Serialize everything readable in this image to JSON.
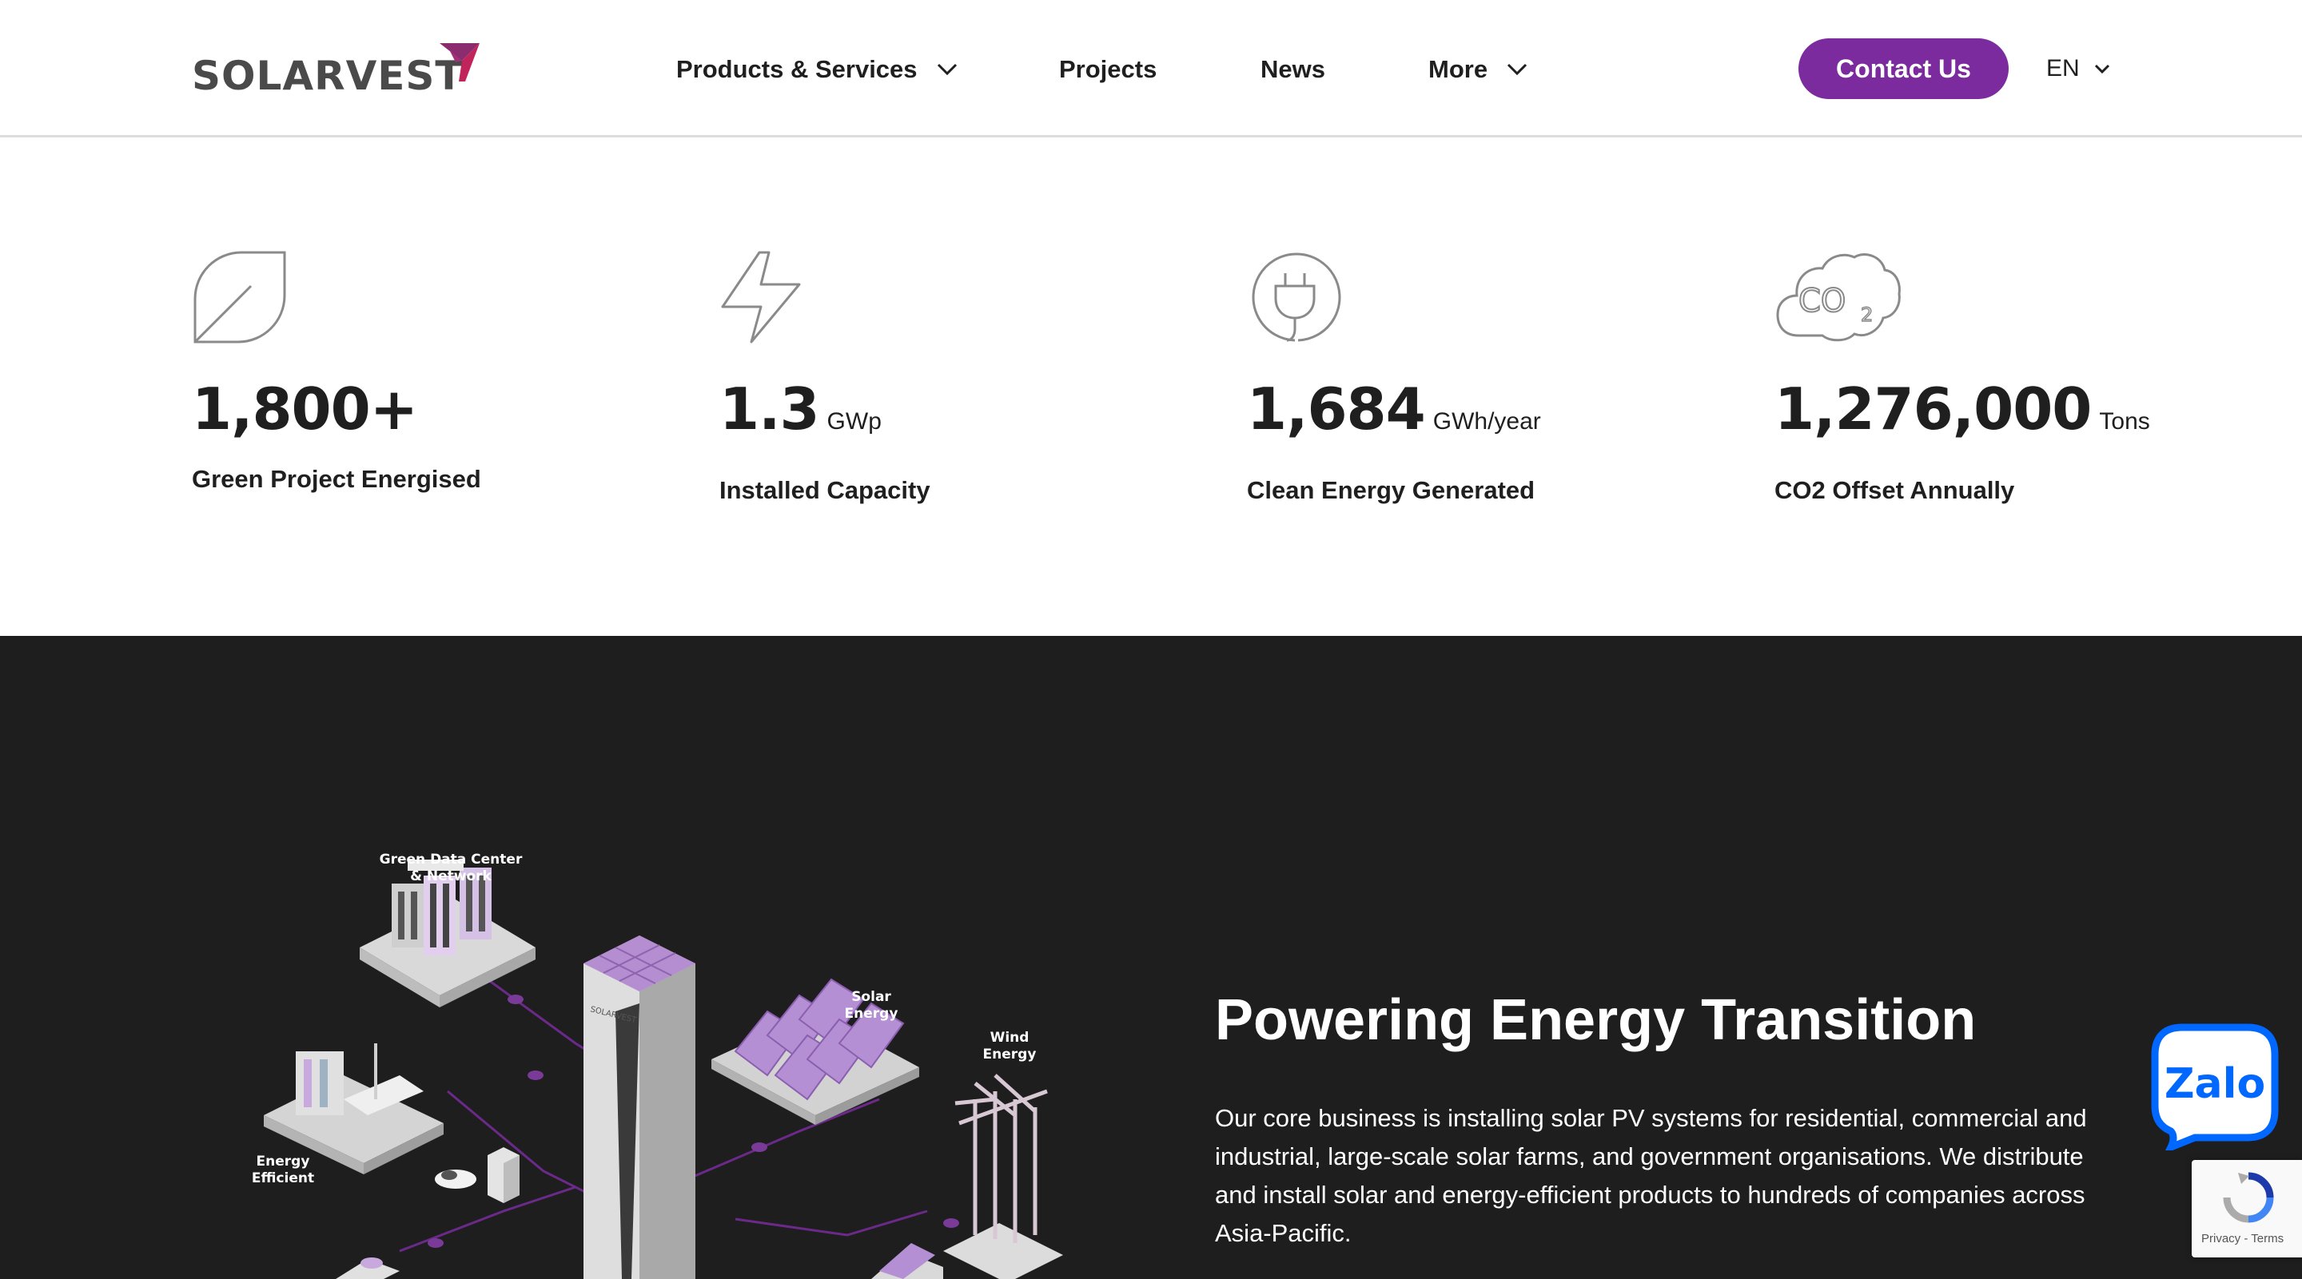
{
  "header": {
    "logo_text": "SOLARVEST",
    "nav": [
      {
        "label": "Products & Services",
        "has_dropdown": true
      },
      {
        "label": "Projects",
        "has_dropdown": false
      },
      {
        "label": "News",
        "has_dropdown": false
      },
      {
        "label": "More",
        "has_dropdown": true
      }
    ],
    "contact_label": "Contact Us",
    "language": "EN"
  },
  "stats": [
    {
      "icon": "leaf-icon",
      "value": "1,800+",
      "unit": "",
      "label": "Green Project Energised"
    },
    {
      "icon": "lightning-icon",
      "value": "1.3",
      "unit": "GWp",
      "label": "Installed Capacity"
    },
    {
      "icon": "plug-icon",
      "value": "1,684",
      "unit": "GWh/year",
      "label": "Clean Energy Generated"
    },
    {
      "icon": "co2-cloud-icon",
      "value": "1,276,000",
      "unit": "Tons",
      "label": "CO2 Offset Annually"
    }
  ],
  "transition": {
    "title": "Powering Energy Transition",
    "body": "Our core business is installing solar PV systems for residential, commercial and industrial, large-scale solar farms, and government organisations. We distribute and install solar and energy-efficient products to hundreds of companies across Asia-Pacific."
  },
  "illustration": {
    "labels": {
      "data_center_line1": "Green Data Center",
      "data_center_line2": "& Network",
      "solar_line1": "Solar",
      "solar_line2": "Energy",
      "wind_line1": "Wind",
      "wind_line2": "Energy",
      "efficient_line1": "Energy",
      "efficient_line2": "Efficient",
      "tower_logo": "SOLARVEST"
    }
  },
  "widgets": {
    "zalo_label": "Zalo",
    "recaptcha_links": "Privacy - Terms"
  },
  "colors": {
    "brand_purple": "#7b2b9e",
    "dark_bg": "#1e1e1f",
    "logo_gray": "#4a4a4a",
    "zalo_blue": "#0068ff"
  }
}
